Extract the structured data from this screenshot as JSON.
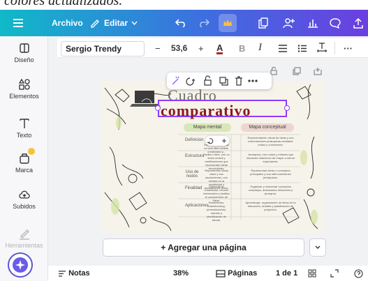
{
  "caption": "colores actualizados.",
  "topbar": {
    "menu_icon": "hamburger-icon",
    "file_label": "Archivo",
    "edit_label": "Editar",
    "icons": [
      "undo-icon",
      "redo-icon",
      "crown-icon",
      "copy-icon",
      "share-people-icon",
      "chart-icon",
      "comment-icon",
      "upload-icon"
    ]
  },
  "sidebar": {
    "items": [
      {
        "label": "Diseño",
        "icon": "layout-icon"
      },
      {
        "label": "Elementos",
        "icon": "shapes-icon"
      },
      {
        "label": "Texto",
        "icon": "text-icon"
      },
      {
        "label": "Marca",
        "icon": "brand-icon"
      },
      {
        "label": "Subidos",
        "icon": "cloud-upload-icon"
      },
      {
        "label": "Herramientas",
        "icon": "pen-icon"
      }
    ]
  },
  "toolbar": {
    "font_name": "Sergio Trendy",
    "decrease": "−",
    "font_size": "53,6",
    "increase": "+",
    "color_letter": "A",
    "bold": "B",
    "italic": "I",
    "more": "···"
  },
  "canvas": {
    "title_top": "Cuadro",
    "title_main": "comparativo",
    "column_headers": [
      "Mapa mental",
      "Mapa conceptual"
    ],
    "rows": [
      {
        "label": "Definicion",
        "c1": "Representación gráfica de información basada en una idea central, creatividad y...",
        "c2": "Representación visual de ideas y sus interrelaciones jerárquicas mediante nodos y conexiones."
      },
      {
        "label": "Estructura",
        "c1": "Radial o libre, con un tema central y ramificaciones que representan ideas secundarias.",
        "c2": "Jerárquica, con nodos y enlaces que muestran relaciones de mayor a menor importancia."
      },
      {
        "label": "Uso de nodos",
        "c1": "Representan ideas clave y sus asociaciones, con énfasis en la creatividad y asociaciones libres.",
        "c2": "Representan ideas o conceptos principales y sus interconexiones jerárquicas."
      },
      {
        "label": "Finalidad",
        "c1": "Estimular la creatividad, resumir información y facilitar la comprensión de ideas.",
        "c2": "Organizar y relacionar conceptos complejos, destacando relaciones y jerarquía."
      },
      {
        "label": "Aplicaciones",
        "c1": "Resúmenes, brainstorming, presentaciones, estudio y planificación de tareas.",
        "c2": "Aprendizaje, organización de ideas en la educación, análisis y planificación de proyectos."
      }
    ]
  },
  "add_page_label": "+ Agregar una página",
  "bottom": {
    "notes_label": "Notas",
    "zoom": "38%",
    "pages_label": "Páginas",
    "page_count": "1 de 1"
  },
  "colors": {
    "accent": "#8b3dff",
    "title_red": "#8b1a1a",
    "header_green": "#d9e6b8",
    "header_pink": "#ecd6cf"
  }
}
